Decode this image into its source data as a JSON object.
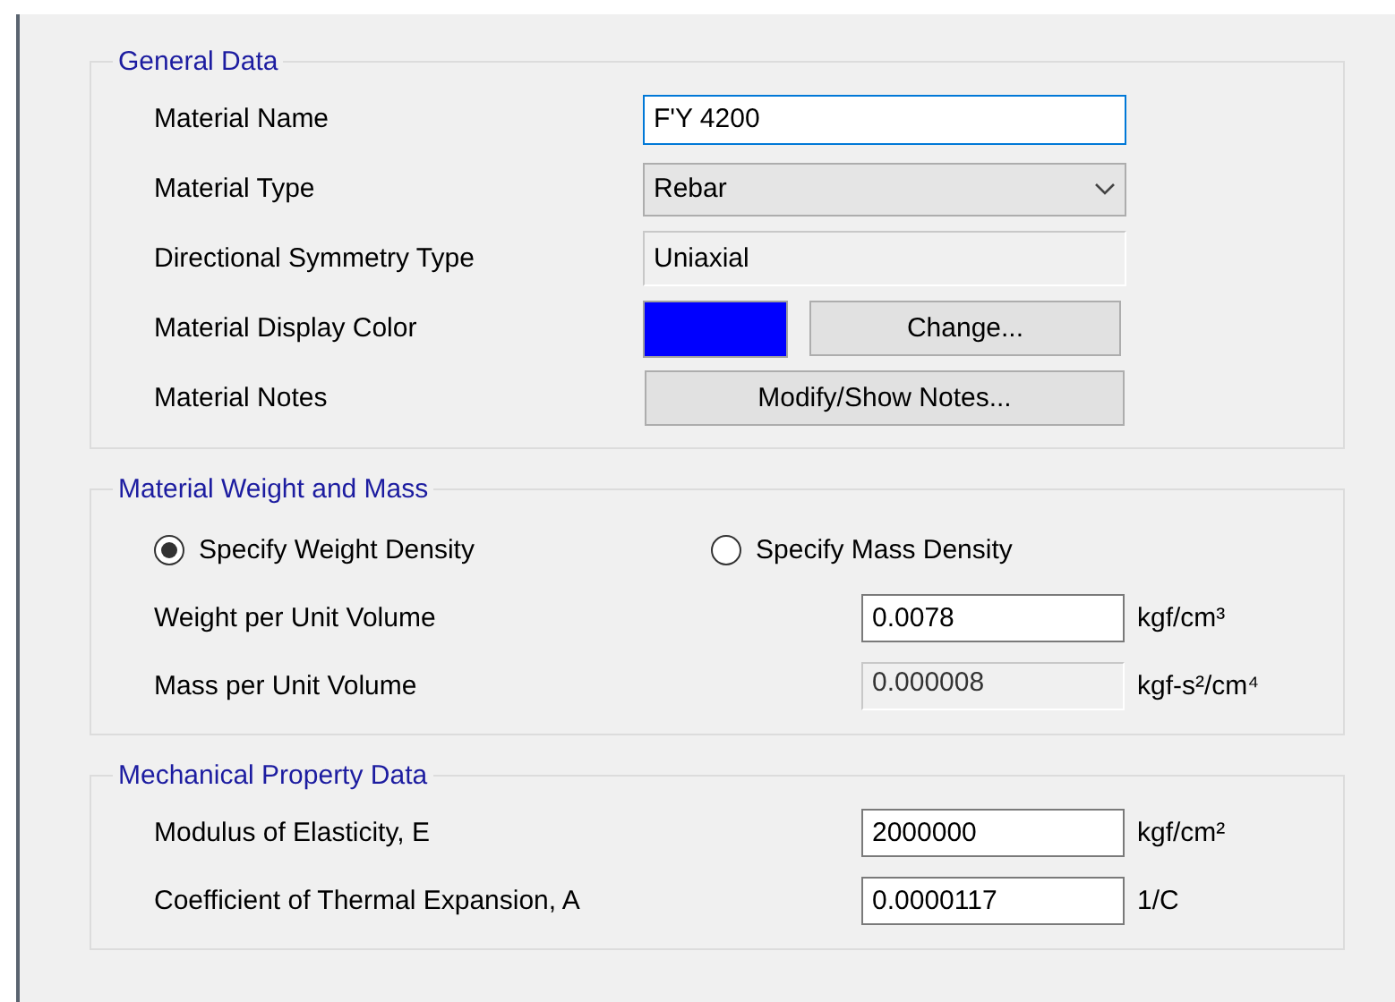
{
  "general": {
    "title": "General Data",
    "rows": [
      {
        "kind": "text",
        "label": "Material Name",
        "value": "F'Y 4200",
        "focused": true
      },
      {
        "kind": "dropdown",
        "label": "Material Type",
        "value": "Rebar"
      },
      {
        "kind": "readonly",
        "label": "Directional Symmetry Type",
        "value": "Uniaxial"
      },
      {
        "kind": "color",
        "label": "Material Display Color",
        "color": "#0000ff",
        "button": "Change..."
      },
      {
        "kind": "button",
        "label": "Material Notes",
        "button": "Modify/Show Notes..."
      }
    ]
  },
  "weight_and_mass": {
    "title": "Material Weight and Mass",
    "options": [
      {
        "label": "Specify Weight Density",
        "selected": true
      },
      {
        "label": "Specify Mass Density",
        "selected": false
      }
    ],
    "rows": [
      {
        "label": "Weight per Unit Volume",
        "value": "0.0078",
        "unit": "kgf/cm³",
        "disabled": false
      },
      {
        "label": "Mass per Unit Volume",
        "value": "0.000008",
        "unit": "kgf-s²/cm⁴",
        "disabled": true
      }
    ]
  },
  "mechanical": {
    "title": "Mechanical Property Data",
    "rows": [
      {
        "label": "Modulus of Elasticity,  E",
        "value": "2000000",
        "unit": "kgf/cm²",
        "disabled": false
      },
      {
        "label": "Coefficient of Thermal Expansion,  A",
        "value": "0.0000117",
        "unit": "1/C",
        "disabled": false
      }
    ]
  }
}
